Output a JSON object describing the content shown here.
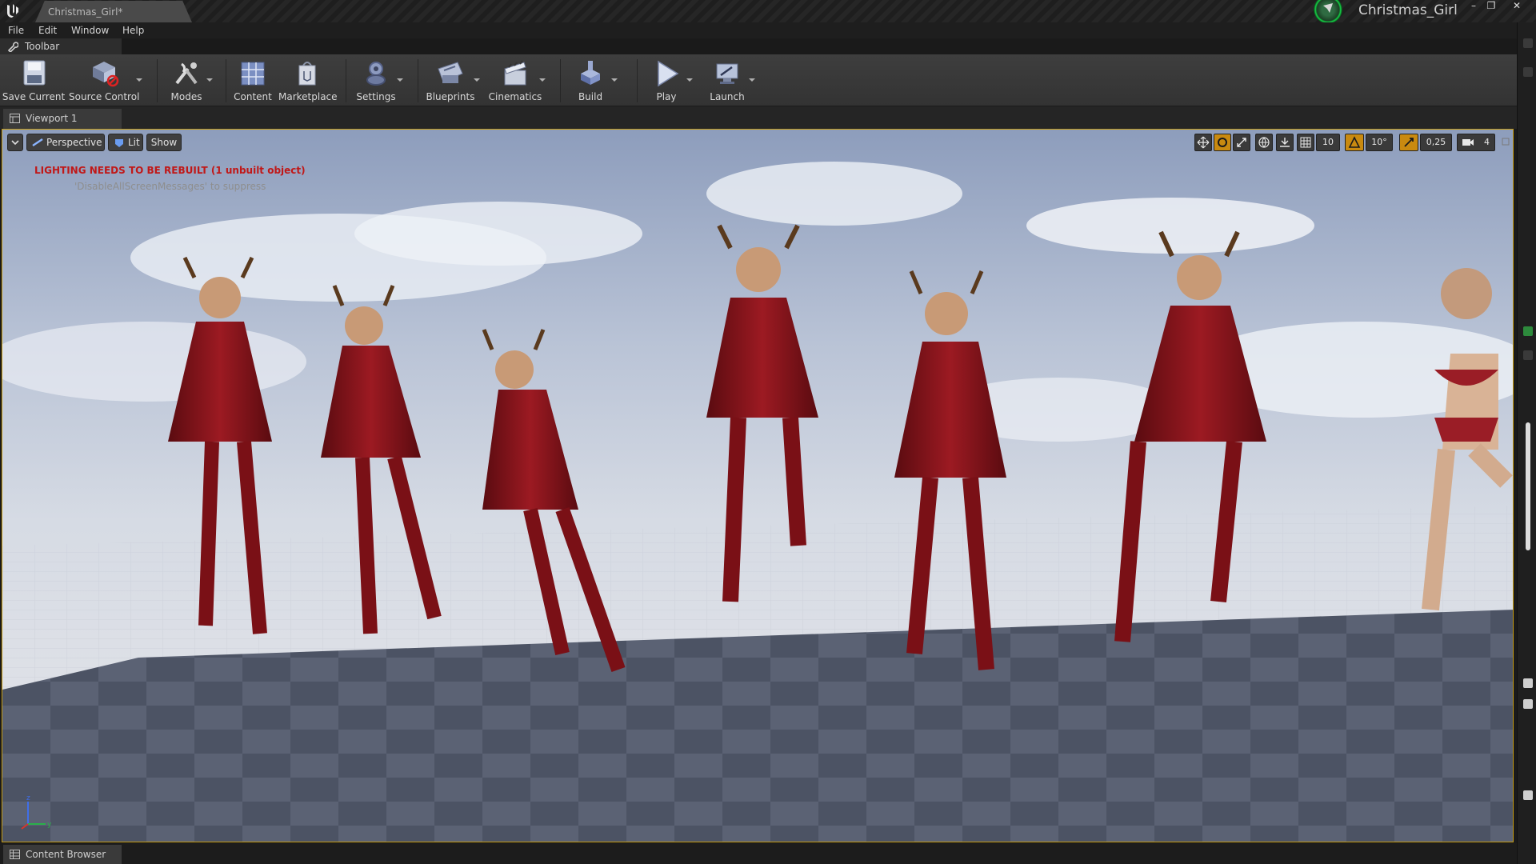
{
  "window": {
    "tab_title": "Christmas_Girl*",
    "project_name": "Christmas_Girl",
    "controls": {
      "minimize": "–",
      "restore": "❐",
      "close": "✕"
    }
  },
  "menu": [
    "File",
    "Edit",
    "Window",
    "Help"
  ],
  "toolbar_tab": {
    "label": "Toolbar",
    "icon": "wrench-icon"
  },
  "toolbar": [
    {
      "label": "Save Current",
      "icon": "save-icon",
      "dropdown": false
    },
    {
      "label": "Source Control",
      "icon": "source-control-icon",
      "dropdown": true
    },
    {
      "label": "Modes",
      "icon": "modes-icon",
      "dropdown": true
    },
    {
      "label": "Content",
      "icon": "content-icon",
      "dropdown": false
    },
    {
      "label": "Marketplace",
      "icon": "marketplace-icon",
      "dropdown": false
    },
    {
      "label": "Settings",
      "icon": "settings-icon",
      "dropdown": true
    },
    {
      "label": "Blueprints",
      "icon": "blueprints-icon",
      "dropdown": true
    },
    {
      "label": "Cinematics",
      "icon": "cinematics-icon",
      "dropdown": true
    },
    {
      "label": "Build",
      "icon": "build-icon",
      "dropdown": true
    },
    {
      "label": "Play",
      "icon": "play-icon",
      "dropdown": true
    },
    {
      "label": "Launch",
      "icon": "launch-icon",
      "dropdown": true
    }
  ],
  "viewport_tab": {
    "label": "Viewport 1"
  },
  "viewport": {
    "view_mode": "Perspective",
    "lighting_mode": "Lit",
    "show_label": "Show",
    "warning": "LIGHTING NEEDS TO BE REBUILT (1 unbuilt object)",
    "warning_hint": "'DisableAllScreenMessages' to suppress",
    "grid_snap": "10",
    "rotation_snap": "10°",
    "scale_snap": "0,25",
    "camera_speed": "4",
    "accent_color": "#c49a12",
    "warning_color": "#c01818"
  },
  "content_browser_tab": {
    "label": "Content Browser"
  }
}
